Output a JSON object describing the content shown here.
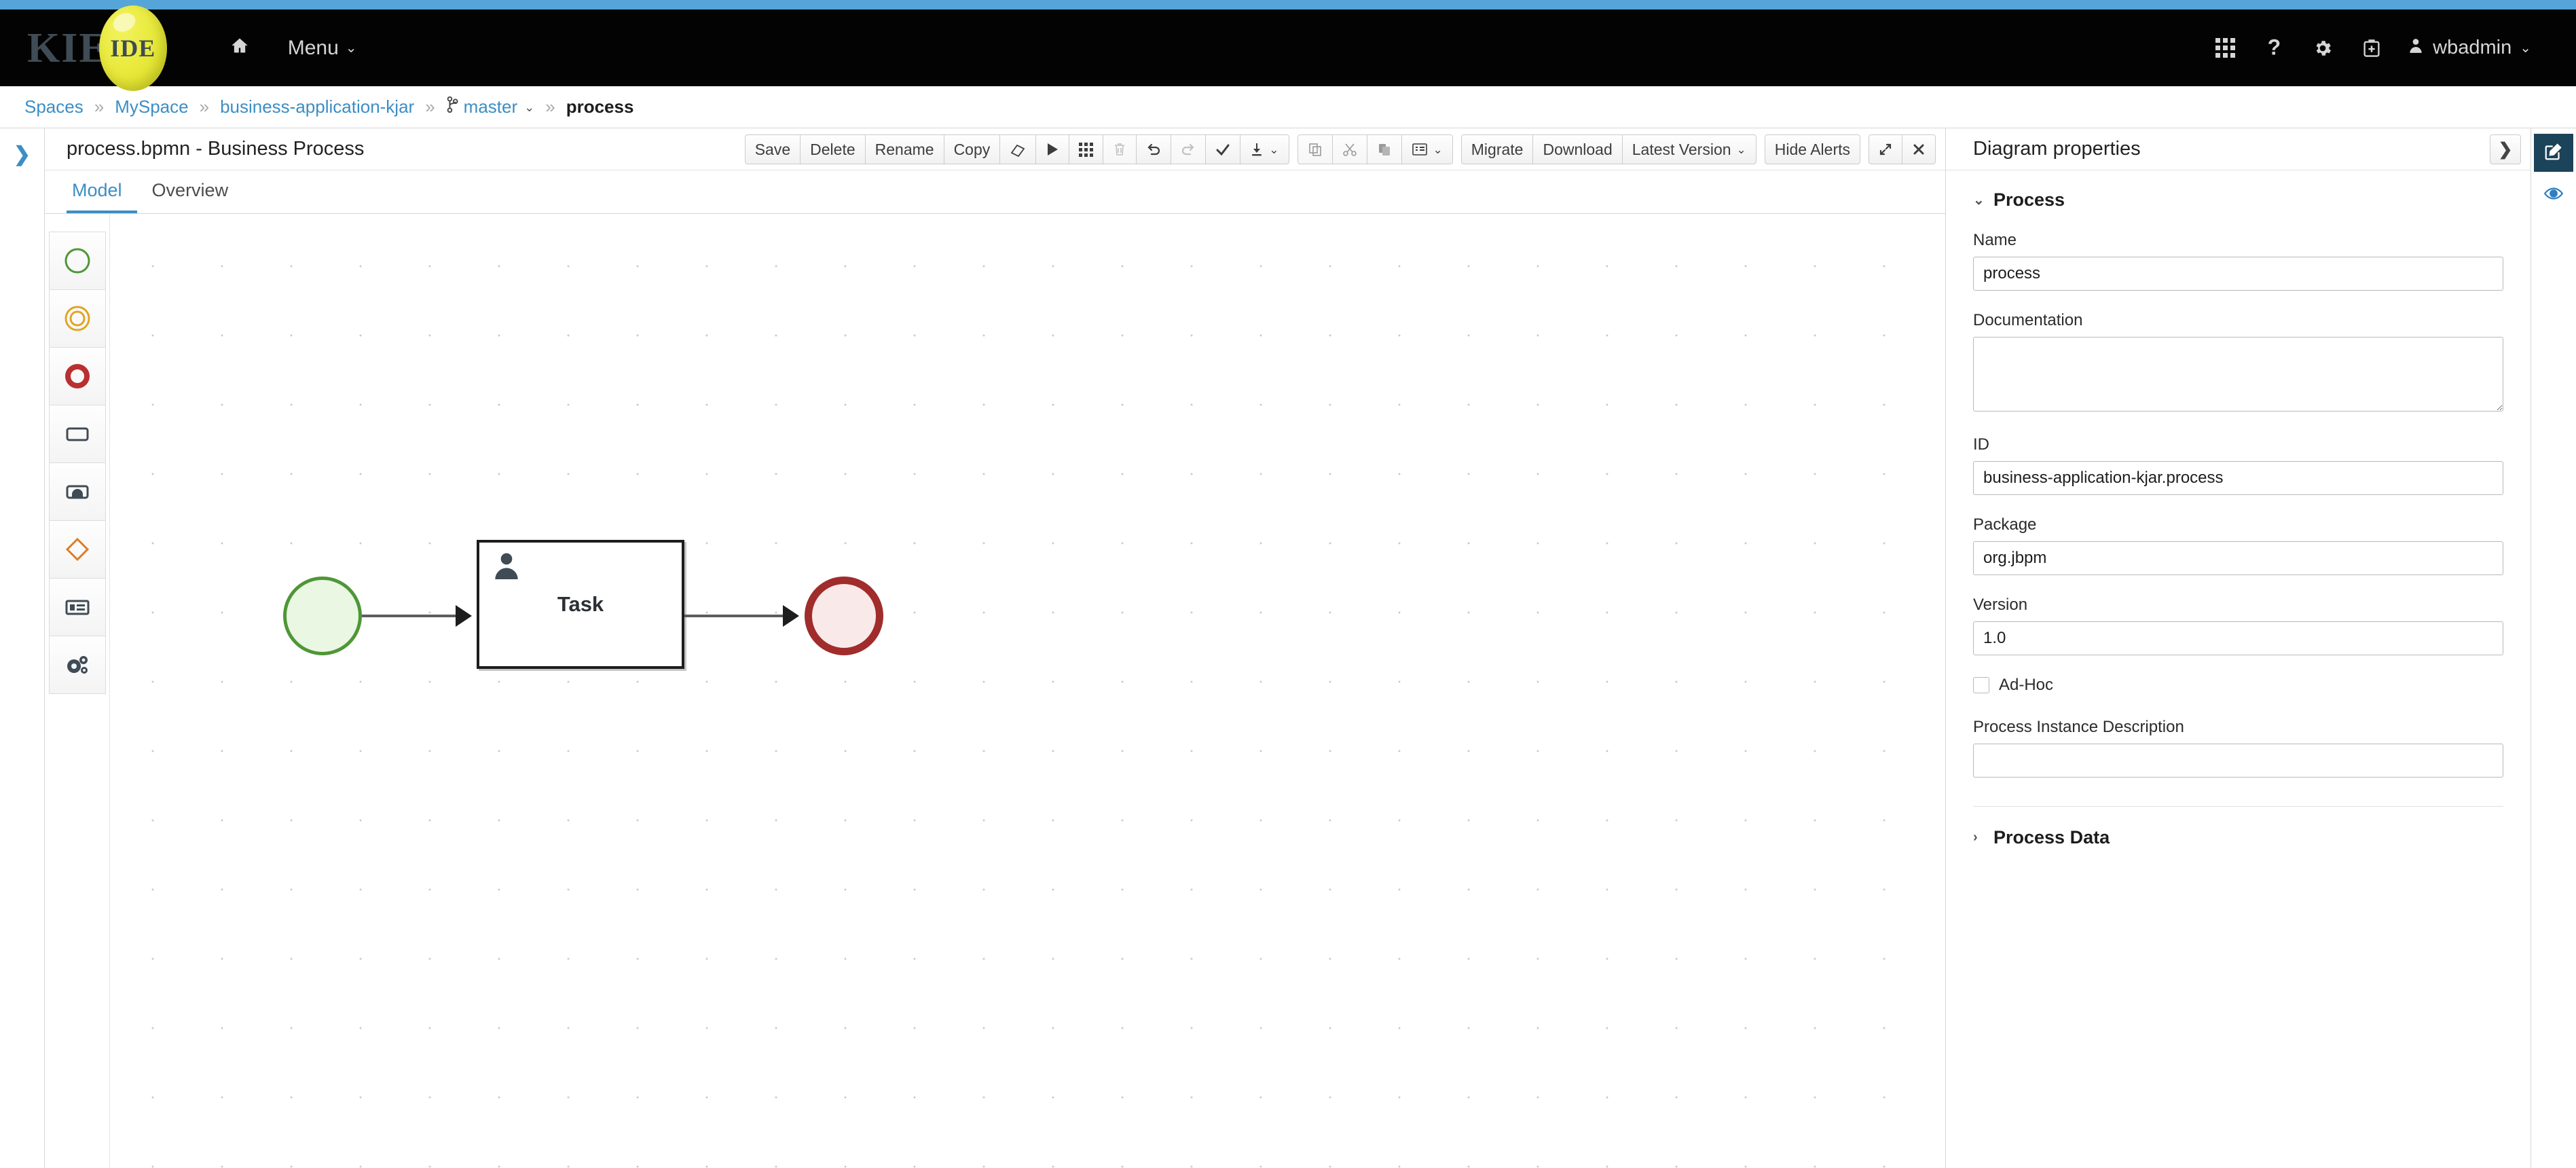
{
  "theme": {
    "accent_bar": "#56a5d8",
    "masthead_bg": "#030303",
    "link_blue": "#3c8ec4",
    "active_rail": "#1b4359",
    "start_event_green": "#4f9637",
    "end_event_red": "#a02c2c",
    "gateway_orange": "#e07b26"
  },
  "masthead": {
    "brand_primary": "KIE",
    "brand_secondary": "IDE",
    "home_icon": "home-icon",
    "menu_label": "Menu",
    "menu_caret": "⌄",
    "icons": [
      {
        "name": "app-launcher-icon",
        "glyph": "grid9"
      },
      {
        "name": "help-icon",
        "glyph": "?"
      },
      {
        "name": "settings-gear-icon",
        "glyph": "gear"
      },
      {
        "name": "first-aid-kit-icon",
        "glyph": "kit"
      }
    ],
    "user": {
      "avatar_icon": "user-avatar-icon",
      "name": "wbadmin",
      "caret": "⌄"
    }
  },
  "breadcrumb": {
    "separator": "»",
    "items": [
      {
        "label": "Spaces",
        "type": "link"
      },
      {
        "label": "MySpace",
        "type": "link"
      },
      {
        "label": "business-application-kjar",
        "type": "link"
      },
      {
        "label": "master",
        "type": "branch",
        "icon": "git-branch-icon",
        "caret": "⌄"
      },
      {
        "label": "process",
        "type": "current"
      }
    ]
  },
  "left_rail": {
    "expand_icon": "chevron-right-icon",
    "expand_glyph": "❯"
  },
  "editor": {
    "title": "process.bpmn - Business Process",
    "tabs": [
      {
        "label": "Model",
        "active": true
      },
      {
        "label": "Overview",
        "active": false
      }
    ],
    "toolbar": {
      "save_label": "Save",
      "delete_label": "Delete",
      "rename_label": "Rename",
      "copy_label": "Copy",
      "migrate_label": "Migrate",
      "download_label": "Download",
      "latest_version_label": "Latest Version",
      "hide_alerts_label": "Hide Alerts",
      "version_caret": "⌄",
      "icons": [
        {
          "name": "eraser-icon",
          "disabled": false
        },
        {
          "name": "play-icon",
          "disabled": false
        },
        {
          "name": "grid-icon",
          "disabled": false
        },
        {
          "name": "trash-icon",
          "disabled": true
        },
        {
          "name": "undo-icon",
          "disabled": false
        },
        {
          "name": "redo-icon",
          "disabled": true
        },
        {
          "name": "checkmark-icon",
          "disabled": false
        },
        {
          "name": "download-dropdown-icon",
          "disabled": false
        },
        {
          "name": "duplicate-icon",
          "disabled": true
        },
        {
          "name": "cut-scissors-icon",
          "disabled": true
        },
        {
          "name": "paste-icon",
          "disabled": true
        },
        {
          "name": "list-view-dropdown-icon",
          "disabled": false
        },
        {
          "name": "expand-arrows-icon",
          "disabled": false
        },
        {
          "name": "close-x-icon",
          "disabled": false
        }
      ]
    }
  },
  "palette": {
    "items": [
      {
        "name": "start-event-tool",
        "shape": "circle-green"
      },
      {
        "name": "intermediate-event-tool",
        "shape": "double-circle-orange"
      },
      {
        "name": "end-event-tool",
        "shape": "thick-circle-red"
      },
      {
        "name": "task-tool",
        "shape": "rounded-rect"
      },
      {
        "name": "subprocess-tool",
        "shape": "subprocess-rect"
      },
      {
        "name": "gateway-tool",
        "shape": "diamond-orange"
      },
      {
        "name": "container-tool",
        "shape": "list-rect"
      },
      {
        "name": "service-tasks-tool",
        "shape": "gears"
      }
    ]
  },
  "diagram": {
    "nodes": [
      {
        "id": "start",
        "type": "start-event",
        "label": ""
      },
      {
        "id": "task",
        "type": "user-task",
        "label": "Task",
        "icon": "user-task-icon"
      },
      {
        "id": "end",
        "type": "end-event",
        "label": ""
      }
    ],
    "connections": [
      {
        "from": "start",
        "to": "task"
      },
      {
        "from": "task",
        "to": "end"
      }
    ]
  },
  "properties": {
    "panel_title": "Diagram properties",
    "collapse_icon": "chevron-right-icon",
    "collapse_glyph": "❯",
    "sections": [
      {
        "id": "process",
        "title": "Process",
        "expanded": true,
        "chevron": "⌄"
      },
      {
        "id": "process_data",
        "title": "Process Data",
        "expanded": false,
        "chevron": "›"
      }
    ],
    "fields": {
      "name": {
        "label": "Name",
        "value": "process",
        "placeholder": ""
      },
      "documentation": {
        "label": "Documentation",
        "value": "",
        "placeholder": ""
      },
      "id": {
        "label": "ID",
        "value": "business-application-kjar.process",
        "placeholder": ""
      },
      "package": {
        "label": "Package",
        "value": "org.jbpm",
        "placeholder": ""
      },
      "version": {
        "label": "Version",
        "value": "1.0",
        "placeholder": ""
      },
      "adhoc": {
        "label": "Ad-Hoc",
        "checked": false
      },
      "process_instance_description": {
        "label": "Process Instance Description",
        "value": "",
        "placeholder": ""
      }
    }
  },
  "right_rail": {
    "items": [
      {
        "name": "properties-edit-tab",
        "icon": "pencil-square-icon",
        "active": true
      },
      {
        "name": "preview-eye-tab",
        "icon": "eye-icon",
        "active": false
      }
    ]
  }
}
